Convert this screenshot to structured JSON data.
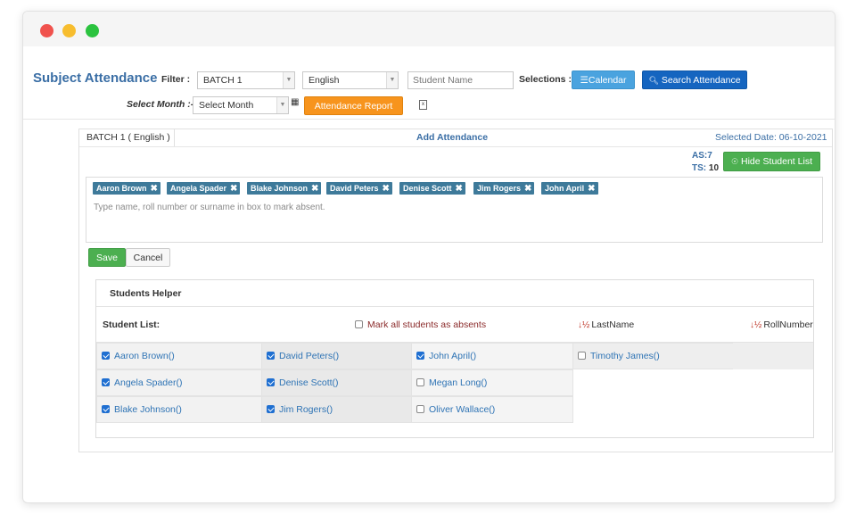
{
  "header": {
    "title": "Subject Attendance",
    "filter_label": "Filter :",
    "batch_value": "BATCH 1",
    "subject_value": "English",
    "student_name_placeholder": "Student Name",
    "selections_label": "Selections :",
    "calendar_label": "Calendar",
    "search_label": "Search Attendance",
    "select_month_label": "Select Month :-",
    "month_value": "Select Month",
    "report_label": "Attendance Report"
  },
  "panel": {
    "batch_tab": "BATCH 1 ( English )",
    "add_attendance": "Add Attendance",
    "selected_date": "Selected Date: 06-10-2021",
    "as_label": "AS:",
    "as_value": "7",
    "ts_label": "TS:",
    "ts_value": "10",
    "hide_list_label": "Hide Student List",
    "tags": [
      "Aaron Brown",
      "Angela Spader",
      "Blake Johnson",
      "David Peters",
      "Denise Scott",
      "Jim Rogers",
      "John April"
    ],
    "tag_hint": "Type name, roll number or surname in box to mark absent.",
    "save_label": "Save",
    "cancel_label": "Cancel"
  },
  "helper": {
    "title": "Students Helper",
    "list_label": "Student List:",
    "mark_all_label": "Mark all students as absents",
    "sort_lastname": "LastName",
    "sort_roll": "RollNumber",
    "students": [
      {
        "name": "Aaron Brown()",
        "checked": true
      },
      {
        "name": "Angela Spader()",
        "checked": true
      },
      {
        "name": "Blake Johnson()",
        "checked": true
      },
      {
        "name": "David Peters()",
        "checked": true
      },
      {
        "name": "Denise Scott()",
        "checked": true
      },
      {
        "name": "Jim Rogers()",
        "checked": true
      },
      {
        "name": "John April()",
        "checked": true
      },
      {
        "name": "Megan Long()",
        "checked": false
      },
      {
        "name": "Oliver Wallace()",
        "checked": false
      },
      {
        "name": "Timothy James()",
        "checked": false
      }
    ]
  },
  "colors": {
    "accent_blue": "#3a6ea5",
    "tag_bg": "#3e7a9a",
    "save_green": "#4caf50",
    "report_orange": "#f7941d"
  }
}
